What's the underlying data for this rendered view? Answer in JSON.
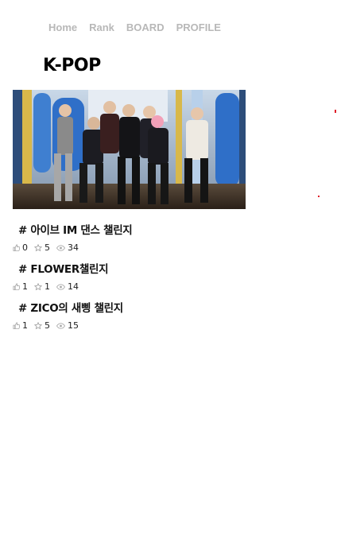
{
  "nav": {
    "items": [
      {
        "label": "Home"
      },
      {
        "label": "Rank"
      },
      {
        "label": "BOARD"
      },
      {
        "label": "PROFILE"
      }
    ]
  },
  "page": {
    "title": "K-POP"
  },
  "hero": {
    "image": "group-dance-stage-photo"
  },
  "posts": [
    {
      "title": "# 아이브 IM 댄스 챌린지",
      "likes": "0",
      "stars": "5",
      "views": "34"
    },
    {
      "title": "# FLOWER챌린지",
      "likes": "1",
      "stars": "1",
      "views": "14"
    },
    {
      "title": "# ZICO의 새삥 챌린지",
      "likes": "1",
      "stars": "5",
      "views": "15"
    }
  ],
  "icons": {
    "like": "thumbs-up-icon",
    "star": "star-icon",
    "view": "eye-icon"
  },
  "colors": {
    "nav_text": "#b8b8b8",
    "title_text": "#000000",
    "accent_red": "#e0202a"
  }
}
